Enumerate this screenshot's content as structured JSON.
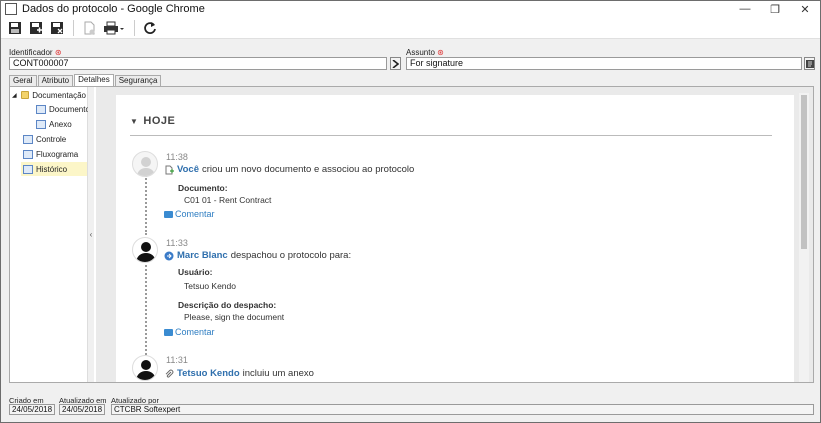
{
  "window": {
    "title": "Dados do protocolo - Google Chrome",
    "controls": {
      "minimize": "—",
      "restore": "❐",
      "close": "✕"
    }
  },
  "toolbar": {
    "buttons": [
      "save-icon",
      "save-new-icon",
      "save-close-icon",
      "new-document-icon",
      "print-icon",
      "refresh-icon"
    ]
  },
  "form": {
    "identifier_label": "Identificador",
    "identifier_value": "CONT000007",
    "subject_label": "Assunto",
    "subject_value": "For signature",
    "required_mark": "⊛"
  },
  "tabs": [
    {
      "label": "Geral",
      "active": false
    },
    {
      "label": "Atributo",
      "active": false
    },
    {
      "label": "Detalhes",
      "active": true
    },
    {
      "label": "Segurança",
      "active": false
    }
  ],
  "tree": [
    {
      "label": "Documentação",
      "expand": "◢"
    },
    {
      "label": "Documento"
    },
    {
      "label": "Anexo"
    },
    {
      "label": "Controle"
    },
    {
      "label": "Fluxograma"
    },
    {
      "label": "Histórico",
      "selected": true
    }
  ],
  "history": {
    "group_label": "HOJE",
    "entries": [
      {
        "time": "11:38",
        "actor": "Você",
        "text": "criou um novo documento e associou ao protocolo",
        "fields": [
          {
            "label": "Documento:",
            "value": "C01 01 - Rent Contract"
          }
        ],
        "comment": "Comentar"
      },
      {
        "time": "11:33",
        "actor": "Marc Blanc",
        "text": "despachou o protocolo para:",
        "fields": [
          {
            "label": "Usuário:",
            "value": "Tetsuo Kendo"
          },
          {
            "label": "Descrição do despacho:",
            "value": "Please, sign the document"
          }
        ],
        "comment": "Comentar"
      },
      {
        "time": "11:31",
        "actor": "Tetsuo Kendo",
        "text": "incluiu um anexo"
      }
    ]
  },
  "footer": {
    "created_label": "Criado em",
    "created_value": "24/05/2018",
    "updated_label": "Atualizado em",
    "updated_value": "24/05/2018",
    "updated_by_label": "Atualizado por",
    "updated_by_value": "CTCBR Softexpert"
  },
  "colors": {
    "link": "#2f6fad",
    "comment": "#2f7ec2",
    "selected_bg": "#fcf6c8"
  }
}
